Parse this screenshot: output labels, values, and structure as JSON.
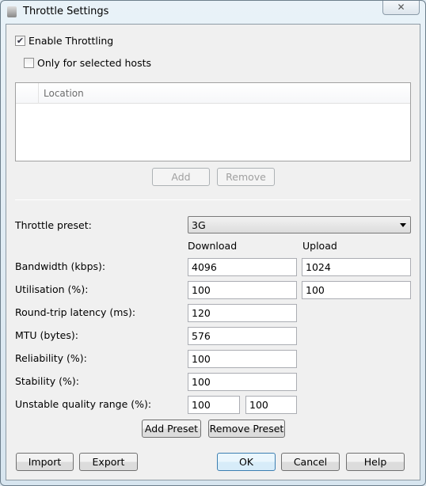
{
  "window": {
    "title": "Throttle Settings",
    "close_icon": "✕"
  },
  "enable_throttling": {
    "label": "Enable Throttling",
    "checked": true
  },
  "only_selected_hosts": {
    "label": "Only for selected hosts",
    "checked": false
  },
  "hosts_list": {
    "column": "Location"
  },
  "list_buttons": {
    "add": "Add",
    "remove": "Remove"
  },
  "preset": {
    "label": "Throttle preset:",
    "value": "3G"
  },
  "columns": {
    "download": "Download",
    "upload": "Upload"
  },
  "fields": {
    "bandwidth": {
      "label": "Bandwidth (kbps):",
      "download": "4096",
      "upload": "1024"
    },
    "utilisation": {
      "label": "Utilisation (%):",
      "download": "100",
      "upload": "100"
    },
    "latency": {
      "label": "Round-trip latency (ms):",
      "value": "120"
    },
    "mtu": {
      "label": "MTU (bytes):",
      "value": "576"
    },
    "reliability": {
      "label": "Reliability (%):",
      "value": "100"
    },
    "stability": {
      "label": "Stability (%):",
      "value": "100"
    },
    "unstable": {
      "label": "Unstable quality range (%):",
      "min": "100",
      "max": "100"
    }
  },
  "preset_buttons": {
    "add": "Add Preset",
    "remove": "Remove Preset"
  },
  "footer": {
    "import": "Import",
    "export": "Export",
    "ok": "OK",
    "cancel": "Cancel",
    "help": "Help"
  }
}
